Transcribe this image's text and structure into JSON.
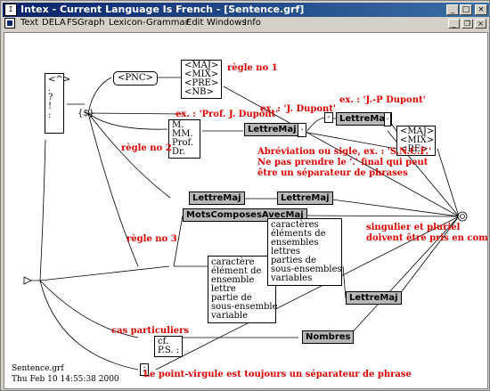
{
  "window": {
    "title": "Intex - Current Language Is French - [Sentence.grf]",
    "controls": [
      "_",
      "□",
      "×"
    ]
  },
  "menu": {
    "items": [
      "Text",
      "DELA",
      "FSGraph",
      "Lexicon-Grammar",
      "Edit",
      "Windows",
      "Info"
    ],
    "controls": [
      "_",
      "❐",
      "×"
    ]
  },
  "graph": {
    "boxes": {
      "punct": [
        "<^>",
        ".",
        "?",
        "!",
        ":"
      ],
      "dollar": "{$}",
      "pnc": "<PNC>",
      "maj_top": [
        "<MAJ>",
        "<MIX>",
        "<PRE>",
        "<NB>"
      ],
      "titles": [
        "M.",
        "MM.",
        "Prof.",
        "Dr."
      ],
      "lettremaj_1": "LettreMaj",
      "dot_1": ".",
      "hyphen": "-",
      "lettremaj_2": "LettreMaj",
      "dot_2": ".",
      "maj_right": [
        "<MAJ>",
        "<MIX>",
        "<RE>"
      ],
      "lettremaj_3": "LettreMaj",
      "lettremaj_4": "LettreMaj",
      "motscomposes": "MotsComposesAvecMaj",
      "chars_mid": [
        "caractère",
        "élément de",
        "ensemble",
        "lettre",
        "partie de",
        "sous-ensemble",
        "variable"
      ],
      "chars_right": [
        "caractères",
        "éléments de",
        "ensembles",
        "lettres",
        "parties de",
        "sous-ensembles",
        "variables"
      ],
      "lettremaj_5": "LettreMaj",
      "cf": [
        "cf.",
        "P.S. :"
      ],
      "nombres": "Nombres",
      "semicolon": ";"
    },
    "labels": {
      "regle1": "règle no 1",
      "regle2": "règle no 2",
      "regle3": "règle no 3",
      "ex_prof": "ex. : 'Prof. J. Dupont'",
      "ex_jdupont": "ex. : 'J. Dupont'",
      "ex_jpdupont": "ex. : 'J.-P Dupont'",
      "abrev": [
        "Abréviation ou sigle, ex. : 'S.N.C.F.'",
        "Ne pas prendre le '.' final qui peut",
        "être un séparateur de phrases"
      ],
      "singulier": [
        "singulier et pluriel",
        "doivent être pris en compte"
      ],
      "cas": "cas particuliers",
      "pointvirgule": "Le point-virgule est toujours un séparateur de phrase"
    },
    "footer": {
      "filename": "Sentence.grf",
      "date": "Thu Feb 10 14:55:38 2000"
    }
  }
}
